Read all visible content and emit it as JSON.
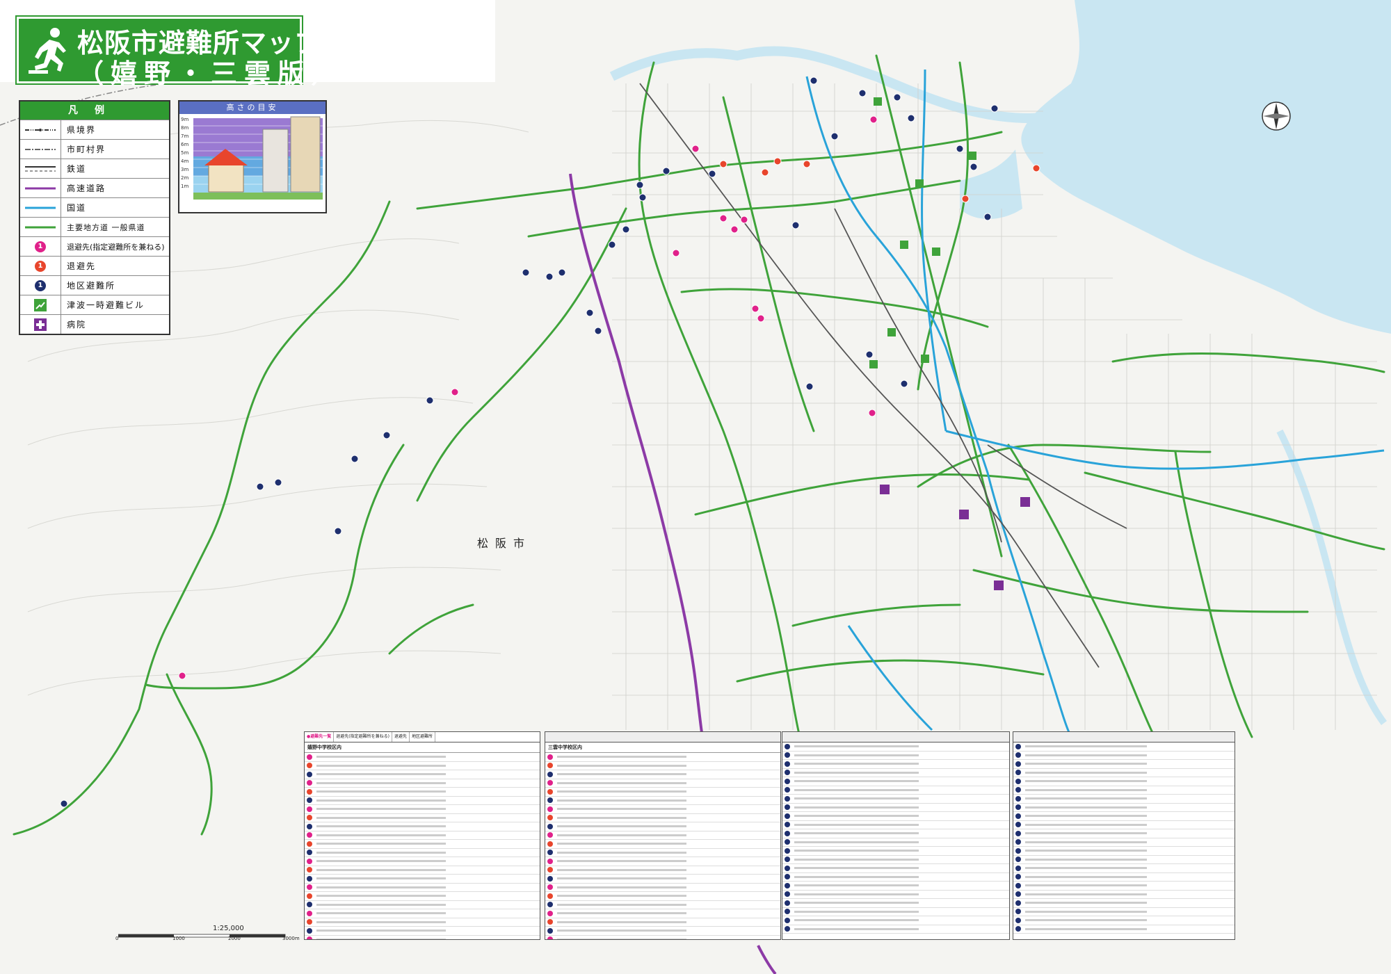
{
  "title": {
    "line1": "松阪市避難所マップ",
    "line2": "（嬉野・三雲版）"
  },
  "legend": {
    "header": "凡例",
    "items": [
      {
        "label": "県境界",
        "symbol": "prefecture-border"
      },
      {
        "label": "市町村界",
        "symbol": "municipal-border"
      },
      {
        "label": "鉄道",
        "symbol": "railway"
      },
      {
        "label": "高速道路",
        "symbol": "expressway"
      },
      {
        "label": "国道",
        "symbol": "national-road"
      },
      {
        "label": "主要地方道 一般県道",
        "symbol": "prefectural-road"
      },
      {
        "label": "退避先(指定避難所を兼ねる)",
        "symbol": "magenta-dot"
      },
      {
        "label": "退避先",
        "symbol": "red-dot"
      },
      {
        "label": "地区避難所",
        "symbol": "navy-dot"
      },
      {
        "label": "津波一時避難ビル",
        "symbol": "tsunami-building"
      },
      {
        "label": "病院",
        "symbol": "hospital"
      }
    ]
  },
  "height_guide": {
    "title": "高さの目安",
    "levels": [
      "9m",
      "8m",
      "7m",
      "6m",
      "5m",
      "4m",
      "3m",
      "2m",
      "1m"
    ]
  },
  "colors": {
    "green_road": "#3fa33a",
    "national_road": "#29a3d9",
    "expressway": "#8c3aa6",
    "magenta": "#e0218a",
    "red": "#e8452c",
    "navy": "#1e2f6e",
    "sea": "#c9e6f2"
  },
  "map_labels": {
    "city": "松阪市",
    "scale": "1:25,000",
    "scale_ticks": [
      "0",
      "1000",
      "2000",
      "3000m"
    ]
  },
  "tables": {
    "header_title": "●避難先一覧",
    "header_legend": [
      "退避先(指定避難所を兼ねる)",
      "退避先",
      "地区避難所"
    ],
    "panel1_section": "嬉野中学校区内",
    "panel2_section": "三雲中学校区内"
  }
}
